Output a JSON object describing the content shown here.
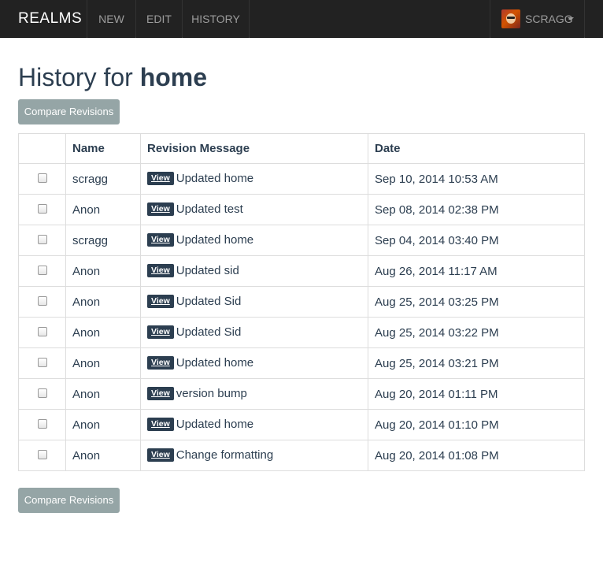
{
  "navbar": {
    "brand": "REALMS",
    "items": [
      {
        "label": "NEW"
      },
      {
        "label": "EDIT"
      },
      {
        "label": "HISTORY"
      }
    ],
    "user": {
      "name": "SCRAGG",
      "avatar_icon": "user-avatar"
    }
  },
  "page": {
    "title_prefix": "History for",
    "title_page": "home",
    "compare_label": "Compare Revisions"
  },
  "table": {
    "columns": {
      "check": "",
      "name": "Name",
      "message": "Revision Message",
      "date": "Date"
    },
    "view_label": "View",
    "rows": [
      {
        "name": "scragg",
        "message": "Updated home",
        "date": "Sep 10, 2014 10:53 AM"
      },
      {
        "name": "Anon",
        "message": "Updated test",
        "date": "Sep 08, 2014 02:38 PM"
      },
      {
        "name": "scragg",
        "message": "Updated home",
        "date": "Sep 04, 2014 03:40 PM"
      },
      {
        "name": "Anon",
        "message": "Updated sid",
        "date": "Aug 26, 2014 11:17 AM"
      },
      {
        "name": "Anon",
        "message": "Updated Sid",
        "date": "Aug 25, 2014 03:25 PM"
      },
      {
        "name": "Anon",
        "message": "Updated Sid",
        "date": "Aug 25, 2014 03:22 PM"
      },
      {
        "name": "Anon",
        "message": "Updated home",
        "date": "Aug 25, 2014 03:21 PM"
      },
      {
        "name": "Anon",
        "message": "version bump",
        "date": "Aug 20, 2014 01:11 PM"
      },
      {
        "name": "Anon",
        "message": "Updated home",
        "date": "Aug 20, 2014 01:10 PM"
      },
      {
        "name": "Anon",
        "message": "Change formatting",
        "date": "Aug 20, 2014 01:08 PM"
      }
    ]
  },
  "colors": {
    "navbar_bg": "#222222",
    "button_bg": "#95a5a6",
    "text": "#2c3e50",
    "view_badge_bg": "#2c3e50"
  }
}
